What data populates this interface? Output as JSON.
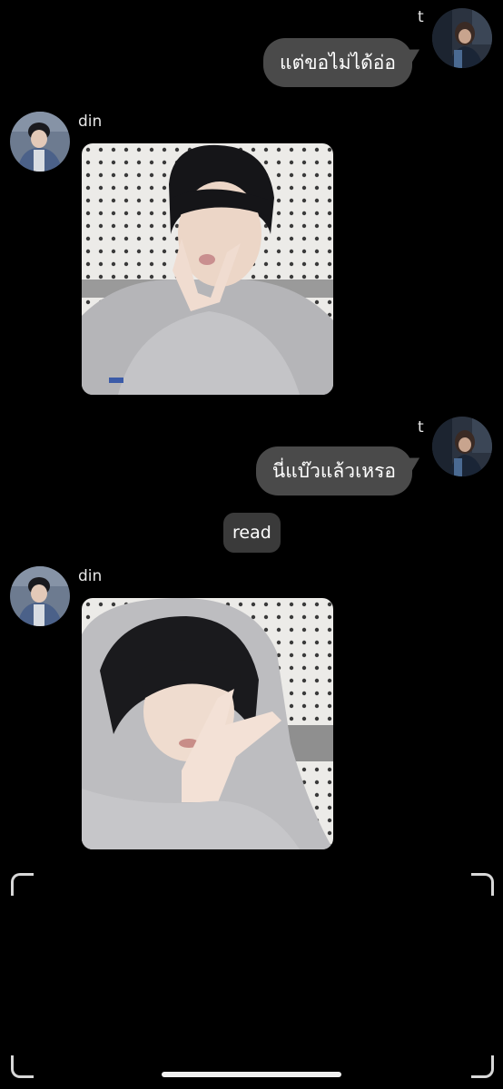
{
  "messages": [
    {
      "sender": "t",
      "direction": "outgoing",
      "text": "แต่ขอไม่ได้อ่อ"
    },
    {
      "sender": "din",
      "direction": "incoming",
      "attachment": "photo"
    },
    {
      "sender": "t",
      "direction": "outgoing",
      "text": "นี่แบ๊วแล้วเหรอ"
    },
    {
      "status": "read"
    },
    {
      "sender": "din",
      "direction": "incoming",
      "attachment": "photo"
    }
  ],
  "colors": {
    "background": "#000000",
    "outgoing_bubble": "#4a4a4a",
    "status_pill": "#3a3a3a",
    "text": "#ffffff"
  },
  "icons": [
    "avatar-t",
    "avatar-din",
    "photo",
    "camera-frame-corner",
    "home-indicator"
  ]
}
